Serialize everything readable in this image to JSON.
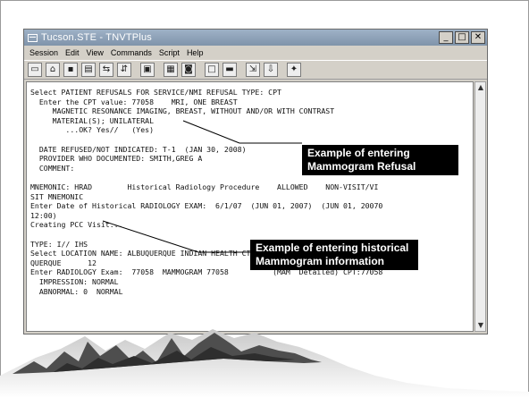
{
  "window": {
    "title": "Tucson.STE - TNVTPlus",
    "controls": {
      "minimize": "_",
      "maximize": "□",
      "close": "✕"
    }
  },
  "menu": [
    "Session",
    "Edit",
    "View",
    "Commands",
    "Script",
    "Help"
  ],
  "toolbar": {
    "buttons": [
      "new-icon",
      "open-icon",
      "save-icon",
      "print-icon",
      "connect-icon",
      "disconnect-icon",
      "copy-icon",
      "paste-icon",
      "capture-icon",
      "blank-icon",
      "minus-icon",
      "transfer-icon",
      "download-icon",
      "settings-icon"
    ]
  },
  "terminal": {
    "lines": [
      "Select PATIENT REFUSALS FOR SERVICE/NMI REFUSAL TYPE: CPT",
      "  Enter the CPT value: 77058    MRI, ONE BREAST",
      "     MAGNETIC RESONANCE IMAGING, BREAST, WITHOUT AND/OR WITH CONTRAST",
      "     MATERIAL(S); UNILATERAL",
      "        ...OK? Yes//   (Yes)",
      "",
      "  DATE REFUSED/NOT INDICATED: T-1  (JAN 30, 2008)",
      "  PROVIDER WHO DOCUMENTED: SMITH,GREG A",
      "  COMMENT:",
      "",
      "MNEMONIC: HRAD        Historical Radiology Procedure    ALLOWED    NON-VISIT/VI",
      "SIT MNEMONIC",
      "Enter Date of Historical RADIOLOGY EXAM:  6/1/07  (JUN 01, 2007)  (JUN 01, 20070",
      "12:00)",
      "Creating PCC Visit...",
      "",
      "TYPE: I// IHS",
      "Select LOCATION NAME: ALBUQUERQUE INDIAN HEALTH CTR       ALBUQUERQUE       ALBU",
      "QUERQUE      12",
      "Enter RADIOLOGY Exam:  77058  MAMMOGRAM 77058          (MAM  Detailed) CPT:77058",
      "  IMPRESSION: NORMAL",
      "  ABNORMAL: 0  NORMAL",
      ""
    ]
  },
  "callouts": {
    "refusal": [
      "Example of entering",
      "Mammogram Refusal"
    ],
    "historical": [
      "Example of entering historical",
      "Mammogram information"
    ]
  },
  "colors": {
    "titlebar": "#8fa3b9",
    "callout_bg": "#000000",
    "mountain_fill": "#555555"
  }
}
